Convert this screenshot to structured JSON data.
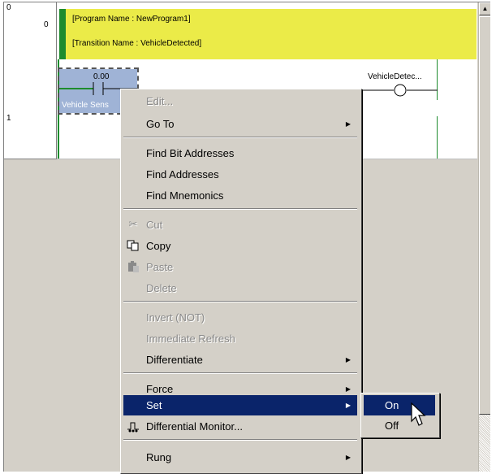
{
  "ladder": {
    "rung0_num_top": "0",
    "rung0_num_mid": "0",
    "rung1_num": "1",
    "program_comment": "[Program Name : NewProgram1]",
    "transition_comment": "[Transition Name : VehicleDetected]",
    "contact_address": "0.00",
    "contact_name": "Vehicle Sens",
    "coil_name": "VehicleDetec..."
  },
  "context_menu": {
    "items": [
      {
        "label": "Edit...",
        "state": "disabled"
      },
      {
        "label": "Go To",
        "submenu": true
      },
      {
        "label": "Find Bit Addresses"
      },
      {
        "label": "Find Addresses"
      },
      {
        "label": "Find Mnemonics"
      },
      {
        "label": "Cut",
        "icon": "scissors-icon",
        "state": "disabled"
      },
      {
        "label": "Copy",
        "icon": "copy-icon"
      },
      {
        "label": "Paste",
        "icon": "paste-icon",
        "state": "disabled"
      },
      {
        "label": "Delete",
        "state": "disabled"
      },
      {
        "label": "Invert (NOT)",
        "state": "disabled"
      },
      {
        "label": "Immediate Refresh",
        "state": "disabled"
      },
      {
        "label": "Differentiate",
        "submenu": true
      },
      {
        "label": "Force",
        "submenu": true
      },
      {
        "label": "Set",
        "submenu": true,
        "state": "selected"
      },
      {
        "label": "Differential Monitor...",
        "icon": "differential-monitor-icon"
      },
      {
        "label": "Rung",
        "submenu": true
      }
    ]
  },
  "set_submenu": {
    "items": [
      {
        "label": "On",
        "state": "selected"
      },
      {
        "label": "Off"
      }
    ]
  },
  "colors": {
    "menu_highlight": "#0a246a",
    "comment_bg": "#ebeb48",
    "rail_green": "#1e8c2e",
    "contact_selected": "#9fb3d6"
  }
}
